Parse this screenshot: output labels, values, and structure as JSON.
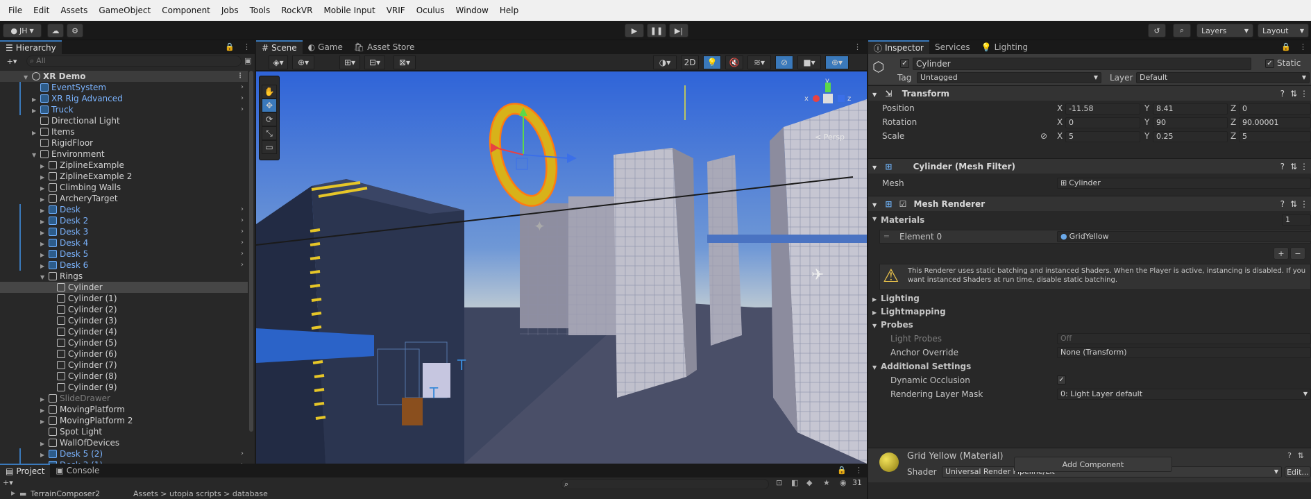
{
  "menu": [
    "File",
    "Edit",
    "Assets",
    "GameObject",
    "Component",
    "Jobs",
    "Tools",
    "RockVR",
    "Mobile Input",
    "VRIF",
    "Oculus",
    "Window",
    "Help"
  ],
  "toolbar": {
    "account": "JH",
    "layers": "Layers",
    "layout": "Layout"
  },
  "hierarchy": {
    "tab": "Hierarchy",
    "search_placeholder": "All",
    "rows": [
      {
        "label": "XR Demo",
        "indent": 0,
        "expanded": true,
        "root": true
      },
      {
        "label": "EventSystem",
        "indent": 1,
        "blue": true,
        "chevron": true
      },
      {
        "label": "XR Rig Advanced",
        "indent": 1,
        "blue": true,
        "collapsed": true,
        "chevron": true
      },
      {
        "label": "Truck",
        "indent": 1,
        "blue": true,
        "collapsed": true,
        "chevron": true
      },
      {
        "label": "Directional Light",
        "indent": 1
      },
      {
        "label": "Items",
        "indent": 1,
        "collapsed": true
      },
      {
        "label": "RigidFloor",
        "indent": 1
      },
      {
        "label": "Environment",
        "indent": 1,
        "expanded": true
      },
      {
        "label": "ZiplineExample",
        "indent": 2,
        "collapsed": true
      },
      {
        "label": "ZiplineExample 2",
        "indent": 2,
        "collapsed": true
      },
      {
        "label": "Climbing Walls",
        "indent": 2,
        "collapsed": true
      },
      {
        "label": "ArcheryTarget",
        "indent": 2,
        "collapsed": true
      },
      {
        "label": "Desk",
        "indent": 2,
        "blue": true,
        "collapsed": true,
        "chevron": true
      },
      {
        "label": "Desk 2",
        "indent": 2,
        "blue": true,
        "collapsed": true,
        "chevron": true
      },
      {
        "label": "Desk 3",
        "indent": 2,
        "blue": true,
        "collapsed": true,
        "chevron": true
      },
      {
        "label": "Desk 4",
        "indent": 2,
        "blue": true,
        "collapsed": true,
        "chevron": true
      },
      {
        "label": "Desk 5",
        "indent": 2,
        "blue": true,
        "collapsed": true,
        "chevron": true
      },
      {
        "label": "Desk 6",
        "indent": 2,
        "blue": true,
        "collapsed": true,
        "chevron": true
      },
      {
        "label": "Rings",
        "indent": 2,
        "expanded": true
      },
      {
        "label": "Cylinder",
        "indent": 3,
        "selected": true
      },
      {
        "label": "Cylinder (1)",
        "indent": 3
      },
      {
        "label": "Cylinder (2)",
        "indent": 3
      },
      {
        "label": "Cylinder (3)",
        "indent": 3
      },
      {
        "label": "Cylinder (4)",
        "indent": 3
      },
      {
        "label": "Cylinder (5)",
        "indent": 3
      },
      {
        "label": "Cylinder (6)",
        "indent": 3
      },
      {
        "label": "Cylinder (7)",
        "indent": 3
      },
      {
        "label": "Cylinder (8)",
        "indent": 3
      },
      {
        "label": "Cylinder (9)",
        "indent": 3
      },
      {
        "label": "SlideDrawer",
        "indent": 2,
        "dim": true,
        "collapsed": true
      },
      {
        "label": "MovingPlatform",
        "indent": 2,
        "collapsed": true
      },
      {
        "label": "MovingPlatform 2",
        "indent": 2,
        "collapsed": true
      },
      {
        "label": "Spot Light",
        "indent": 2
      },
      {
        "label": "WallOfDevices",
        "indent": 2,
        "collapsed": true
      },
      {
        "label": "Desk 5 (2)",
        "indent": 2,
        "blue": true,
        "collapsed": true,
        "chevron": true
      },
      {
        "label": "Desk 3 (1)",
        "indent": 2,
        "blue": true,
        "collapsed": true,
        "chevron": true
      }
    ]
  },
  "scene": {
    "tabs": [
      "Scene",
      "Game",
      "Asset Store"
    ],
    "mode_2d": "2D",
    "persp": "< Persp",
    "gizmo_axes": {
      "x": "x",
      "y": "y",
      "z": "z"
    }
  },
  "inspector": {
    "tabs": [
      "Inspector",
      "Services",
      "Lighting"
    ],
    "object_name": "Cylinder",
    "static_label": "Static",
    "tag_label": "Tag",
    "tag_value": "Untagged",
    "layer_label": "Layer",
    "layer_value": "Default",
    "transform": {
      "title": "Transform",
      "position": {
        "label": "Position",
        "x": "-11.58",
        "y": "8.41",
        "z": "0"
      },
      "rotation": {
        "label": "Rotation",
        "x": "0",
        "y": "90",
        "z": "90.00001"
      },
      "scale": {
        "label": "Scale",
        "x": "5",
        "y": "0.25",
        "z": "5"
      }
    },
    "mesh_filter": {
      "title": "Cylinder (Mesh Filter)",
      "mesh_label": "Mesh",
      "mesh_value": "Cylinder"
    },
    "mesh_renderer": {
      "title": "Mesh Renderer",
      "materials_label": "Materials",
      "materials_count": "1",
      "element_label": "Element 0",
      "element_value": "GridYellow",
      "warning": "This Renderer uses static batching and instanced Shaders. When the Player is active, instancing is disabled. If you want instanced Shaders at run time, disable static batching.",
      "lighting": "Lighting",
      "lightmapping": "Lightmapping",
      "probes": "Probes",
      "light_probes_label": "Light Probes",
      "light_probes_value": "Off",
      "anchor_label": "Anchor Override",
      "anchor_value": "None (Transform)",
      "additional": "Additional Settings",
      "dynamic_occlusion": "Dynamic Occlusion",
      "rendering_layer_label": "Rendering Layer Mask",
      "rendering_layer_value": "0: Light Layer default"
    },
    "material": {
      "title": "Grid Yellow (Material)",
      "shader_label": "Shader",
      "shader_value": "Universal Render Pipeline/Lit",
      "edit": "Edit..."
    },
    "add_component": "Add Component"
  },
  "project": {
    "tabs": [
      "Project",
      "Console"
    ],
    "count": "31",
    "folder": "TerrainComposer2",
    "breadcrumb": "Assets > utopia scripts > database"
  },
  "colors": {
    "accent": "#3a79bb",
    "selection": "#2c5d87",
    "prefab": "#7bb4ff"
  }
}
